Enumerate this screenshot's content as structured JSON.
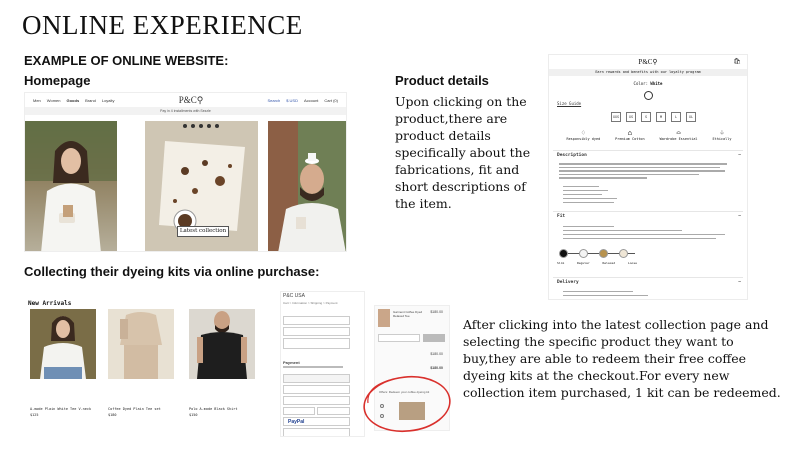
{
  "title": "ONLINE EXPERIENCE",
  "example_heading": "EXAMPLE OF ONLINE WEBSITE:",
  "homepage_heading": "Homepage",
  "collecting_heading": "Collecting their dyeing kits via online purchase:",
  "product_details_heading": "Product details",
  "product_details_text": "Upon clicking on the product,there are product details specifically about the fabrications, fit and short descriptions of the item.",
  "checkout_text": "After clicking into the latest collection page and selecting the specific product they want to buy,they are able to redeem their free coffee dyeing kits at the checkout.For every new collection item purchased, 1 kit can be redeemed.",
  "homepage": {
    "nav_left": [
      "Men",
      "Women",
      "Goods",
      "Brand",
      "Loyalty"
    ],
    "logo": "P&C⚲",
    "nav_right": [
      "Search",
      "$ USD",
      "Account",
      "Cart (0)"
    ],
    "promo": "Pay in 4 installments with Sezzle",
    "cta": "Latest collection"
  },
  "product_page": {
    "logo": "P&C⚲",
    "promo": "Earn rewards and benefits with our loyalty program",
    "color_label": "Color:",
    "color_value": "White",
    "size_guide": "Size Guide",
    "sizes": [
      "XXS",
      "XS",
      "S",
      "M",
      "L",
      "XL"
    ],
    "features": [
      "Responsibly dyed",
      "Premium Cotton",
      "Wardrobe Essential",
      "Ethically"
    ],
    "description_heading": "Description",
    "fit_heading": "Fit",
    "fit_swatches": [
      "Slim",
      "Regular",
      "Relaxed",
      "Loose"
    ],
    "delivery_heading": "Delivery"
  },
  "new_arrivals": {
    "heading": "New Arrivals",
    "items": [
      {
        "name": "A-mode Plain White Tee V-neck",
        "price": "$125"
      },
      {
        "name": "Coffee Dyed Plain Tee set",
        "price": "$180"
      },
      {
        "name": "Polo A-mode Black Shirt",
        "price": "$150"
      }
    ]
  },
  "checkout_mock": {
    "store": "P&C USA",
    "breadcrumb": "Cart > Information > Shipping > Payment",
    "payment_label": "Payment",
    "paypal": "PayPal",
    "summary_title": "Garment Coffee Dyed Relaxed Tee",
    "summary_price": "$180.00",
    "subtotal": "$180.00",
    "total": "$180.00",
    "redeem_text": "Offers: Redeem your coffee dyeing kit"
  },
  "colors": {
    "accent_red": "#d9302c",
    "swatch_colors": [
      "#111111",
      "#f4f4f4",
      "#b8934f",
      "#efe6d6"
    ]
  }
}
